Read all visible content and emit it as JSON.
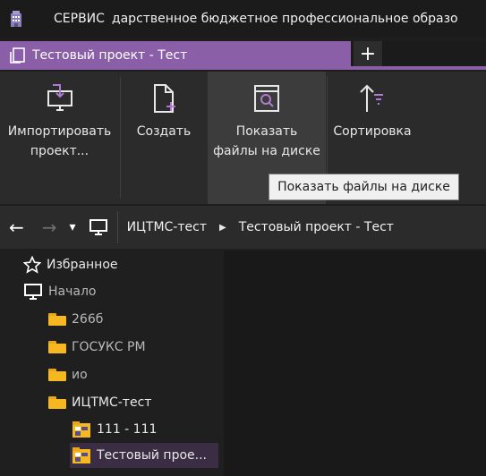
{
  "titlebar": {
    "label": "СЕРВИС",
    "org": "дарственное бюджетное профессиональное образо"
  },
  "tab": {
    "title": "Тестовый проект - Тест",
    "new_tab": "+"
  },
  "ribbon": {
    "import_l1": "Импортировать",
    "import_l2": "проект...",
    "create": "Создать",
    "show_l1": "Показать",
    "show_l2": "файлы на диске",
    "sort": "Сортировка"
  },
  "tooltip": "Показать файлы на диске",
  "nav": {
    "back": "←",
    "forward": "→",
    "dropdown": "▾",
    "crumbs": [
      "ИЦТМС-тест",
      "Тестовый проект - Тест"
    ],
    "crumb_sep": "▶"
  },
  "tree": {
    "favorites": "Избранное",
    "home": "Начало",
    "folders": [
      "266б",
      "ГОСУКС РМ",
      "ио",
      "ИЦТМС-тест"
    ],
    "projects": [
      "111 - 111",
      "Тестовый прое..."
    ]
  },
  "colors": {
    "accent": "#8a5fa8",
    "folder": "#f5b820",
    "tooltip_bg": "#f0f0f0"
  }
}
